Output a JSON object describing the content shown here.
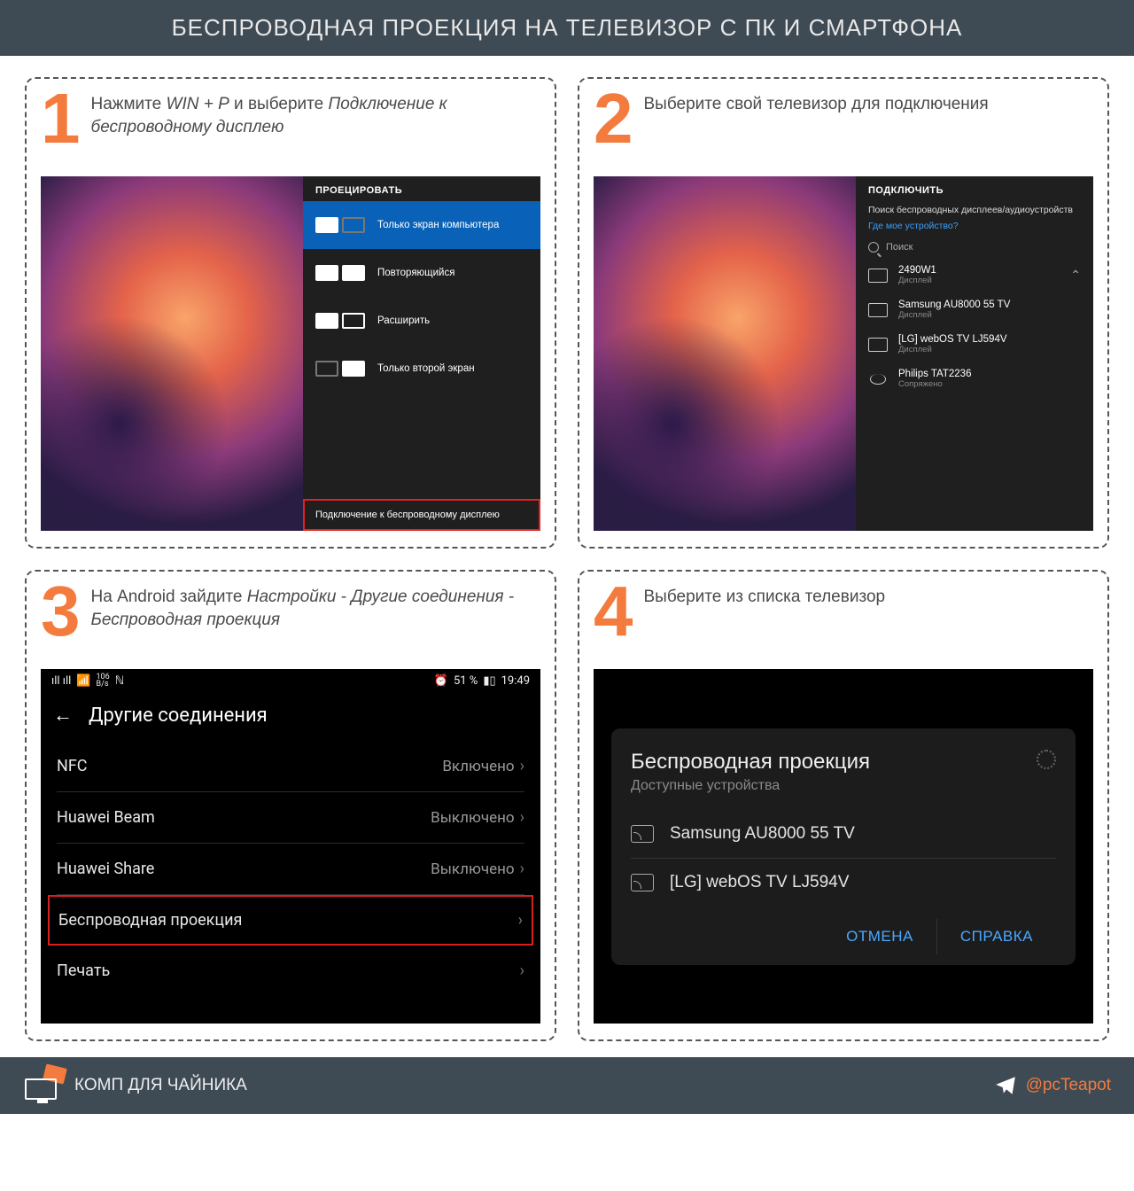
{
  "header": {
    "title": "БЕСПРОВОДНАЯ ПРОЕКЦИЯ НА ТЕЛЕВИЗОР С ПК И СМАРТФОНА"
  },
  "steps": {
    "s1": {
      "num": "1",
      "text_a": "Нажмите ",
      "text_em1": "WIN + P",
      "text_b": " и выберите ",
      "text_em2": "Подключение к беспроводному дисплею",
      "panel_title": "ПРОЕЦИРОВАТЬ",
      "opt1": "Только экран компьютера",
      "opt2": "Повторяющийся",
      "opt3": "Расширить",
      "opt4": "Только второй экран",
      "wireless": "Подключение к беспроводному дисплею"
    },
    "s2": {
      "num": "2",
      "text": "Выберите свой телевизор для подключения",
      "panel_title": "ПОДКЛЮЧИТЬ",
      "sub1": "Поиск беспроводных дисплеев/аудиоустройств",
      "sub2": "Где мое устройство?",
      "search": "Поиск",
      "devices": [
        {
          "name": "2490W1",
          "sub": "Дисплей"
        },
        {
          "name": "Samsung AU8000 55 TV",
          "sub": "Дисплей"
        },
        {
          "name": "[LG] webOS TV LJ594V",
          "sub": "Дисплей"
        },
        {
          "name": "Philips TAT2236",
          "sub": "Сопряжено"
        }
      ]
    },
    "s3": {
      "num": "3",
      "text_a": "На Android зайдите ",
      "text_em": "Настройки - Другие соединения - Беспроводная проекция",
      "status_left": "ıll ıll",
      "status_speed": "106",
      "status_unit": "B/s",
      "status_nfc": "ℕ",
      "status_alarm": "⏰",
      "status_batt": "51 %",
      "status_time": "19:49",
      "title": "Другие соединения",
      "rows": [
        {
          "label": "NFC",
          "value": "Включено"
        },
        {
          "label": "Huawei Beam",
          "value": "Выключено"
        },
        {
          "label": "Huawei Share",
          "value": "Выключено"
        },
        {
          "label": "Беспроводная проекция",
          "value": "",
          "hl": true
        },
        {
          "label": "Печать",
          "value": ""
        }
      ]
    },
    "s4": {
      "num": "4",
      "text": "Выберите из списка телевизор",
      "card_title": "Беспроводная проекция",
      "card_sub": "Доступные устройства",
      "dev1": "Samsung AU8000 55 TV",
      "dev2": "[LG] webOS TV LJ594V",
      "btn_cancel": "ОТМЕНА",
      "btn_help": "СПРАВКА"
    }
  },
  "footer": {
    "brand": "КОМП ДЛЯ ЧАЙНИКА",
    "handle": "@pcTeapot"
  }
}
